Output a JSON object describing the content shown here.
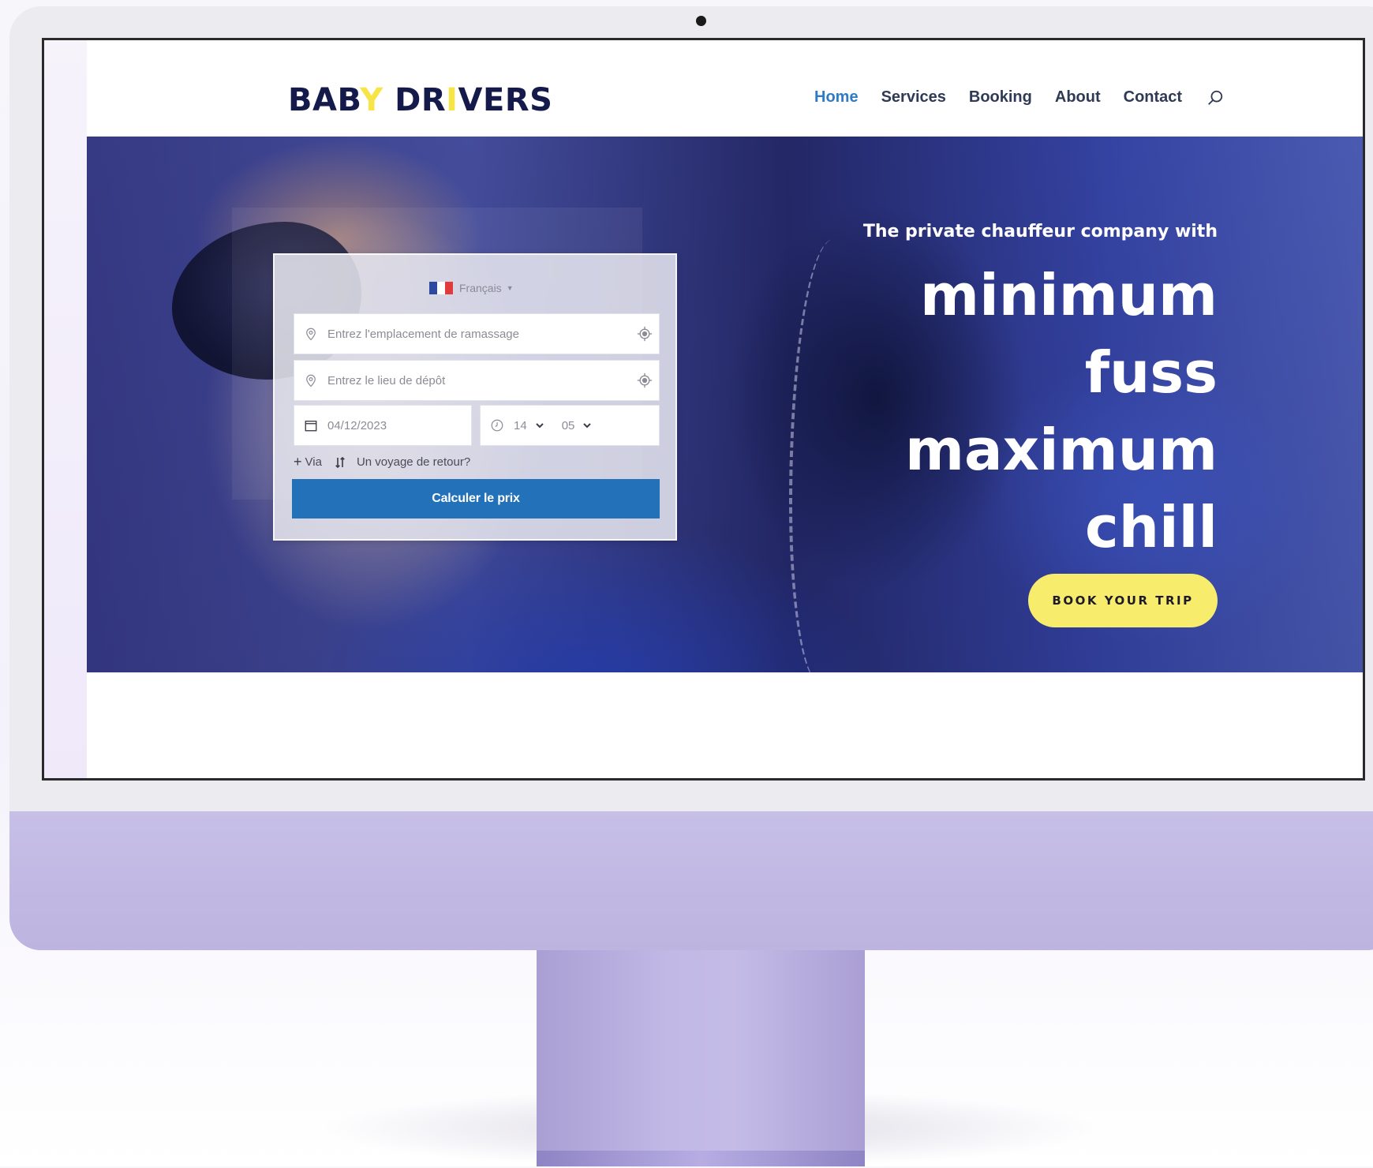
{
  "site": {
    "logo": {
      "part1": "BAB",
      "accent1": "Y",
      "part2": " DR",
      "accent2": "I",
      "part3": "VERS"
    },
    "nav": [
      {
        "label": "Home",
        "active": true
      },
      {
        "label": "Services",
        "active": false
      },
      {
        "label": "Booking",
        "active": false
      },
      {
        "label": "About",
        "active": false
      },
      {
        "label": "Contact",
        "active": false
      }
    ],
    "nav_icon": "search-icon"
  },
  "booking": {
    "language": "Français",
    "pickup_placeholder": "Entrez l'emplacement de ramassage",
    "dropoff_placeholder": "Entrez le lieu de dépôt",
    "date": "04/12/2023",
    "hour": "14",
    "minute": "05",
    "via_label": "Via",
    "return_label": "Un voyage de retour?",
    "submit_label": "Calculer le prix"
  },
  "hero": {
    "tagline": "The private chauffeur company with",
    "headline": [
      "minimum",
      "fuss",
      "maximum",
      "chill"
    ],
    "cta_label": "BOOK YOUR TRIP"
  },
  "colors": {
    "brand_navy": "#141a4a",
    "brand_yellow": "#f7e447",
    "nav_active": "#2f7bc5",
    "button_blue": "#2371b8",
    "cta_yellow": "#f8ec6c",
    "monitor_purple": "#c1b8e6"
  }
}
